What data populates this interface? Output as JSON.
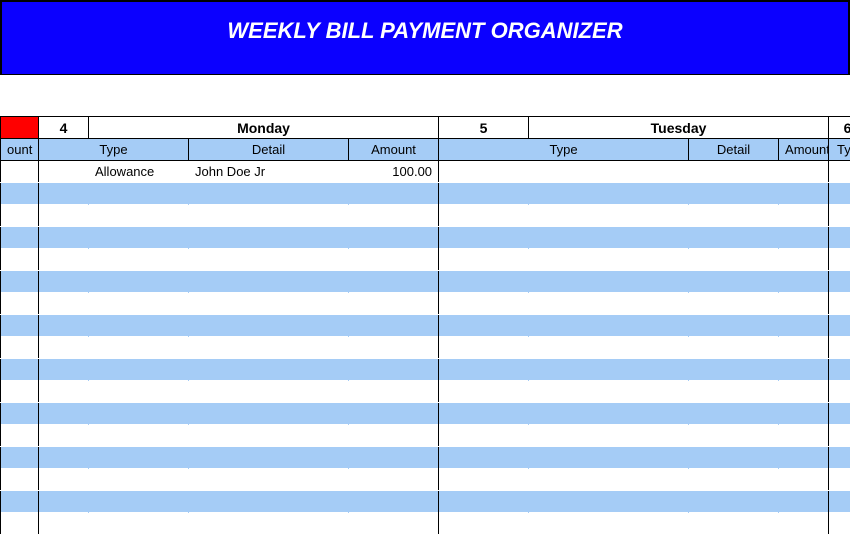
{
  "title": "WEEKLY BILL PAYMENT ORGANIZER",
  "days": {
    "prev_num": "4",
    "mon_label": "Monday",
    "mon_num": "5",
    "tue_label": "Tuesday",
    "tue_num": "6"
  },
  "subheaders": {
    "amount_prev": "ount",
    "type": "Type",
    "detail": "Detail",
    "amount": "Amount",
    "type2": "Type",
    "detail2": "Detail",
    "amount2": "Amount",
    "type3": "Typ"
  },
  "rows": [
    {
      "type": "Allowance",
      "detail": "John Doe Jr",
      "amount": "100.00"
    },
    {},
    {},
    {},
    {},
    {},
    {},
    {},
    {},
    {},
    {},
    {},
    {},
    {},
    {},
    {},
    {}
  ]
}
